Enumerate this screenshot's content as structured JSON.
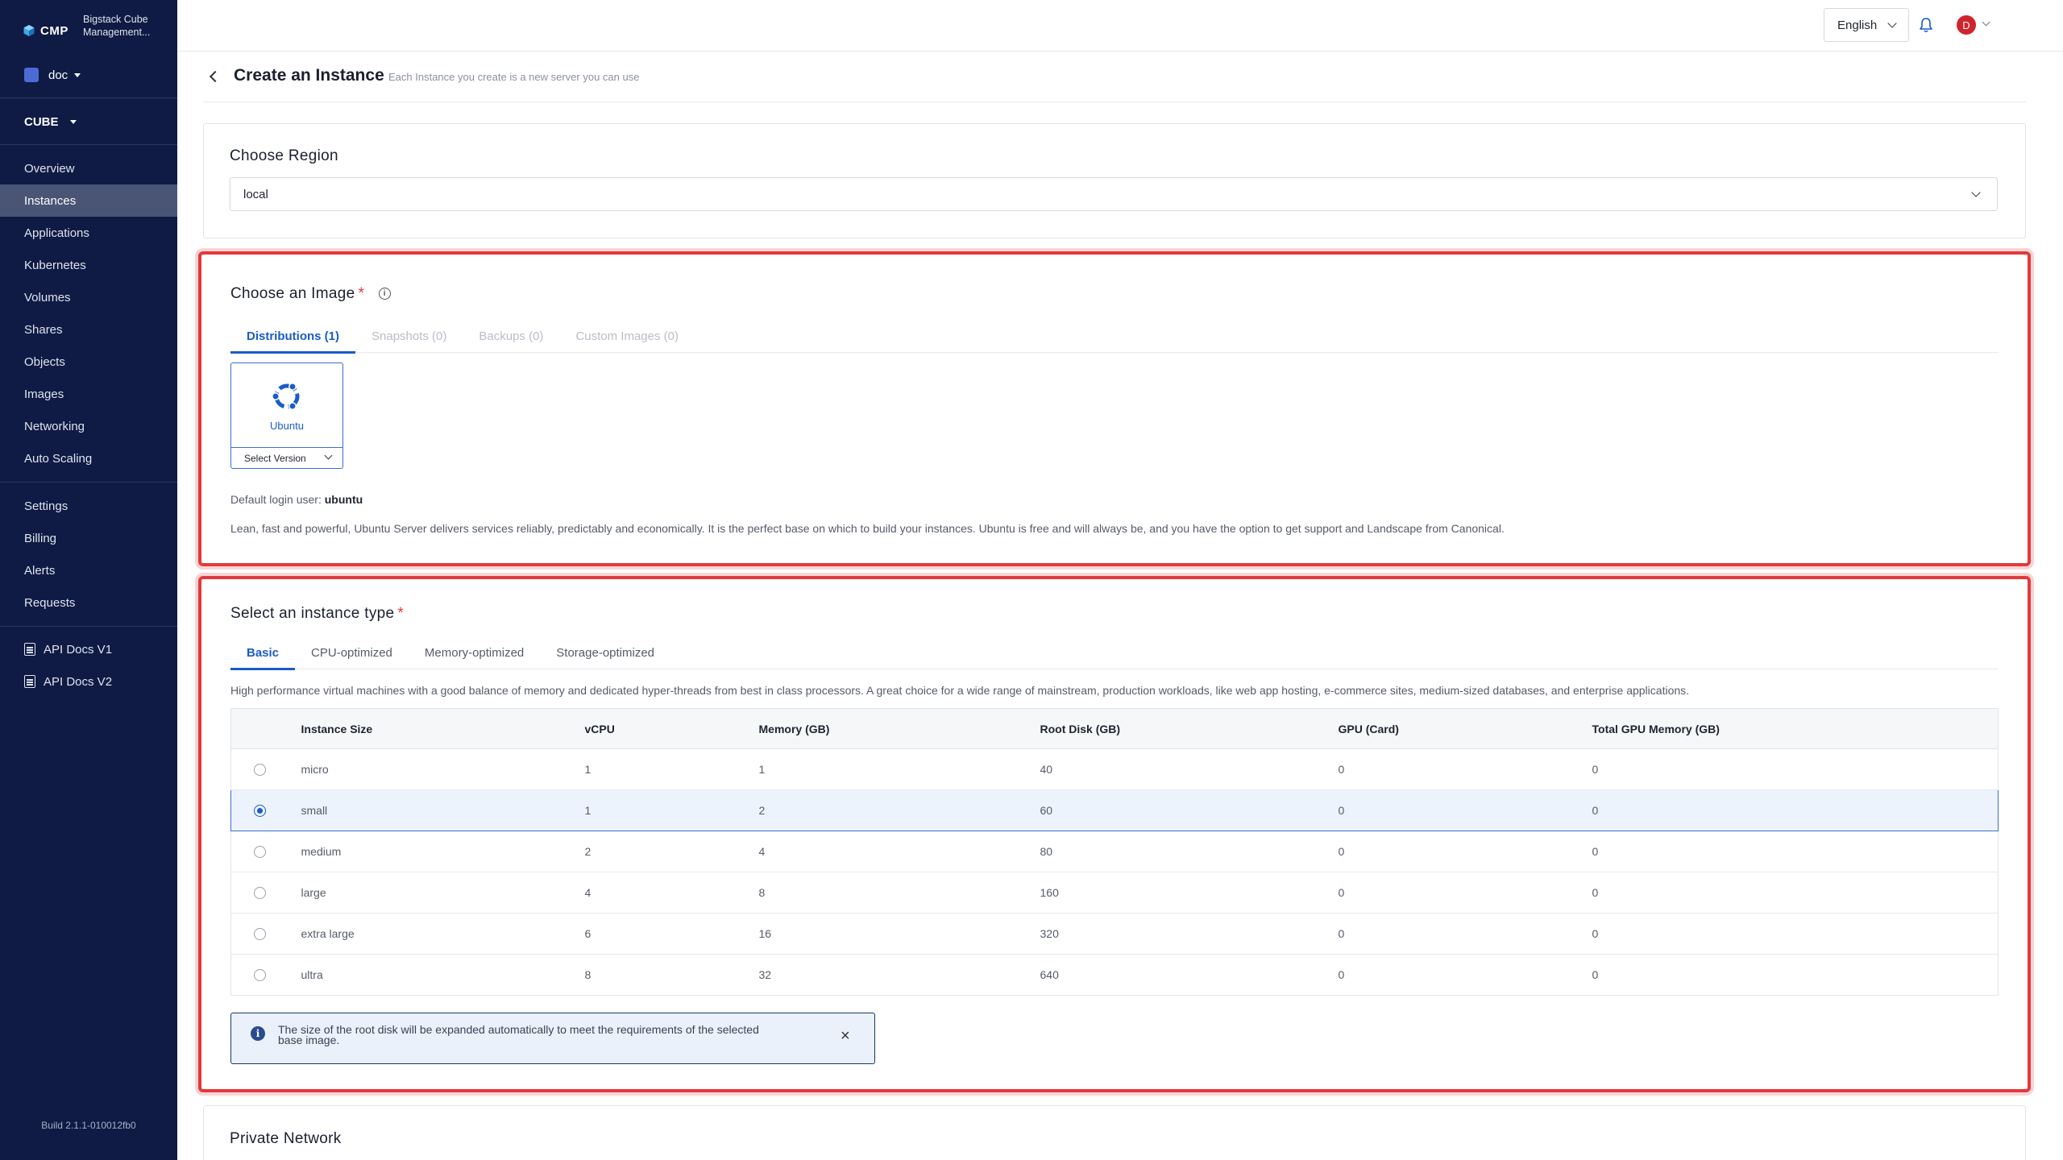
{
  "brand": {
    "name": "CMP",
    "title": "Bigstack Cube Management..."
  },
  "org": {
    "name": "doc"
  },
  "project": {
    "name": "CUBE"
  },
  "sidebar": {
    "nav": [
      "Overview",
      "Instances",
      "Applications",
      "Kubernetes",
      "Volumes",
      "Shares",
      "Objects",
      "Images",
      "Networking",
      "Auto Scaling"
    ],
    "active_item": "Instances",
    "settings_nav": [
      "Settings",
      "Billing",
      "Alerts",
      "Requests"
    ],
    "docs_nav": [
      "API Docs V1",
      "API Docs V2"
    ],
    "build": "Build 2.1.1-010012fb0"
  },
  "topbar": {
    "language": "English",
    "avatar_initial": "D",
    "avatar_color": "#d0242d"
  },
  "page": {
    "title": "Create an Instance",
    "subtitle": "Each Instance you create is a new server you can use"
  },
  "region": {
    "title": "Choose Region",
    "value": "local"
  },
  "image": {
    "title": "Choose an Image",
    "required_mark": "*",
    "tabs": [
      "Distributions (1)",
      "Snapshots (0)",
      "Backups (0)",
      "Custom Images (0)"
    ],
    "active_tab": "Distributions (1)",
    "distribution": {
      "name": "Ubuntu",
      "version_placeholder": "Select Version"
    },
    "login_label": "Default login user:",
    "login_user": "ubuntu",
    "description": "Lean, fast and powerful, Ubuntu Server delivers services reliably, predictably and economically. It is the perfect base on which to build your instances. Ubuntu is free and will always be, and you have the option to get support and Landscape from Canonical."
  },
  "instance_type": {
    "title": "Select an instance type",
    "required_mark": "*",
    "tabs": [
      "Basic",
      "CPU-optimized",
      "Memory-optimized",
      "Storage-optimized"
    ],
    "active_tab": "Basic",
    "description": "High performance virtual machines with a good balance of memory and dedicated hyper-threads from best in class processors. A great choice for a wide range of mainstream, production workloads, like web app hosting, e-commerce sites, medium-sized databases, and enterprise applications.",
    "columns": [
      "Instance Size",
      "vCPU",
      "Memory (GB)",
      "Root Disk (GB)",
      "GPU (Card)",
      "Total GPU Memory (GB)"
    ],
    "rows": [
      [
        "micro",
        "1",
        "1",
        "40",
        "0",
        "0"
      ],
      [
        "small",
        "1",
        "2",
        "60",
        "0",
        "0"
      ],
      [
        "medium",
        "2",
        "4",
        "80",
        "0",
        "0"
      ],
      [
        "large",
        "4",
        "8",
        "160",
        "0",
        "0"
      ],
      [
        "extra large",
        "6",
        "16",
        "320",
        "0",
        "0"
      ],
      [
        "ultra",
        "8",
        "32",
        "640",
        "0",
        "0"
      ]
    ],
    "selected_row": "small",
    "notice": "The size of the root disk will be expanded automatically to meet the requirements of the selected base image."
  },
  "private_network": {
    "title": "Private Network"
  },
  "colors": {
    "sidebar_bg": "#0f1b44",
    "accent": "#1a5cc8",
    "highlight": "#e4393c"
  }
}
